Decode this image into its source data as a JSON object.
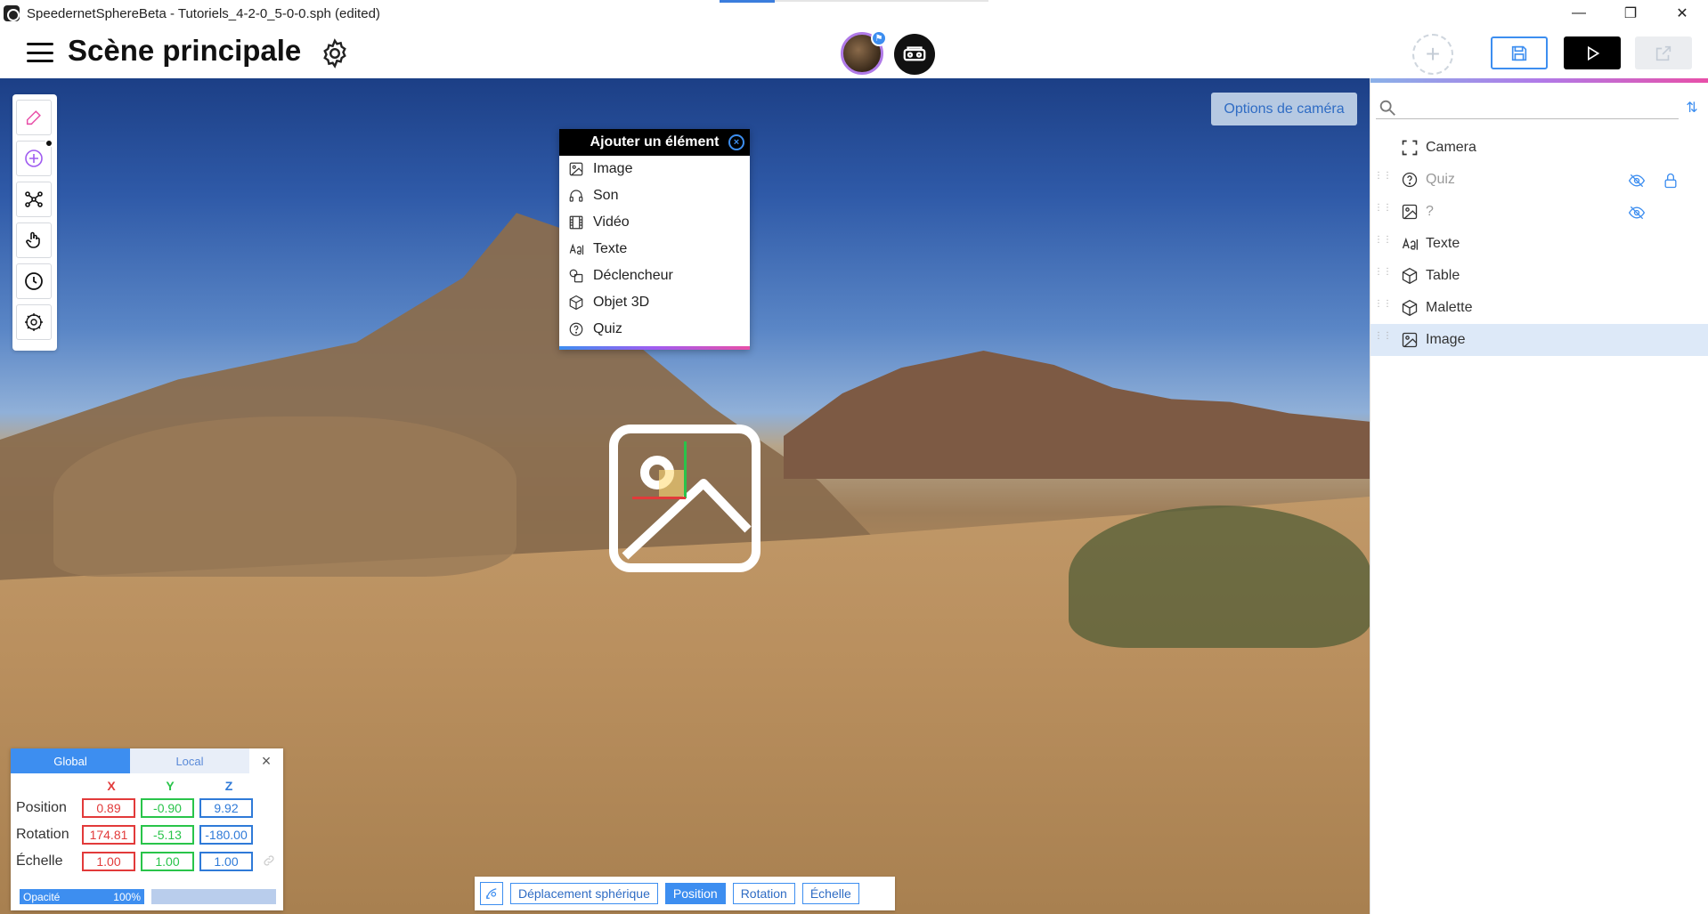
{
  "window": {
    "title": "SpeedernetSphereBeta - Tutoriels_4-2-0_5-0-0.sph (edited)",
    "minimize": "—",
    "maximize": "❐",
    "close": "✕"
  },
  "header": {
    "scene_title": "Scène principale",
    "avatar_badge": "⚑",
    "add_label": "+"
  },
  "viewport": {
    "camera_options": "Options de caméra"
  },
  "add_popup": {
    "title": "Ajouter un élément",
    "close": "×",
    "items": [
      {
        "label": "Image",
        "icon": "image-icon"
      },
      {
        "label": "Son",
        "icon": "headphones-icon"
      },
      {
        "label": "Vidéo",
        "icon": "film-icon"
      },
      {
        "label": "Texte",
        "icon": "text-icon"
      },
      {
        "label": "Déclencheur",
        "icon": "trigger-icon"
      },
      {
        "label": "Objet 3D",
        "icon": "cube-icon"
      },
      {
        "label": "Quiz",
        "icon": "question-icon"
      }
    ]
  },
  "transform_panel": {
    "tabs": {
      "global": "Global",
      "local": "Local"
    },
    "close": "×",
    "axes": {
      "x": "X",
      "y": "Y",
      "z": "Z"
    },
    "rows": [
      {
        "label": "Position",
        "x": "0.89",
        "y": "-0.90",
        "z": "9.92"
      },
      {
        "label": "Rotation",
        "x": "174.81",
        "y": "-5.13",
        "z": "-180.00"
      },
      {
        "label": "Échelle",
        "x": "1.00",
        "y": "1.00",
        "z": "1.00"
      }
    ],
    "opacity_label": "Opacité",
    "opacity_value": "100%"
  },
  "mode_bar": {
    "modes": [
      "Déplacement sphérique",
      "Position",
      "Rotation",
      "Échelle"
    ],
    "active": "Position"
  },
  "right_panel": {
    "search_placeholder": "",
    "sort_icon": "⇅",
    "items": [
      {
        "label": "Camera",
        "icon": "camera-frame-icon",
        "muted": false,
        "hidden": false,
        "locked": false,
        "selected": false
      },
      {
        "label": "Quiz",
        "icon": "question-icon",
        "muted": true,
        "hidden": true,
        "locked": true,
        "selected": false
      },
      {
        "label": "?",
        "icon": "image-icon",
        "muted": true,
        "hidden": true,
        "locked": false,
        "selected": false
      },
      {
        "label": "Texte",
        "icon": "text-icon",
        "muted": false,
        "hidden": false,
        "locked": false,
        "selected": false
      },
      {
        "label": "Table",
        "icon": "cube-icon",
        "muted": false,
        "hidden": false,
        "locked": false,
        "selected": false
      },
      {
        "label": "Malette",
        "icon": "cube-icon",
        "muted": false,
        "hidden": false,
        "locked": false,
        "selected": false
      },
      {
        "label": "Image",
        "icon": "image-icon",
        "muted": false,
        "hidden": false,
        "locked": false,
        "selected": true
      }
    ]
  },
  "colors": {
    "accent": "#3d8ef0",
    "x_axis": "#e23a3a",
    "y_axis": "#29c44a",
    "z_axis": "#2f7ad8"
  }
}
